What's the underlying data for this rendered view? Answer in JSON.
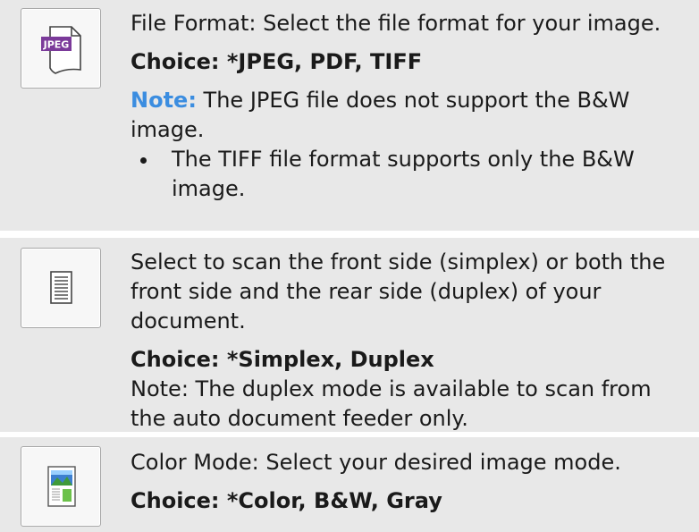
{
  "format": {
    "icon": "jpeg-file-icon",
    "icon_text": "JPEG",
    "desc": "File Format: Select the file format for your image.",
    "choice": "Choice: *JPEG, PDF, TIFF",
    "note_label": "Note:",
    "note_text": " The JPEG file does not support the B&W image.",
    "bullet": "The TIFF file format supports only the B&W image."
  },
  "duplex": {
    "icon": "document-page-icon",
    "desc": "Select to scan the front side (simplex) or both the front side and the rear side (duplex) of your document.",
    "choice": "Choice: *Simplex, Duplex",
    "note": "Note: The duplex mode is available to scan from the auto document feeder only."
  },
  "color": {
    "icon": "color-image-icon",
    "desc": "Color Mode: Select your desired image mode.",
    "choice": "Choice: *Color, B&W, Gray"
  },
  "colors": {
    "row_bg": "#e8e8e8",
    "note_blue": "#3b8de0",
    "jpeg_purple": "#7b3a9a"
  }
}
